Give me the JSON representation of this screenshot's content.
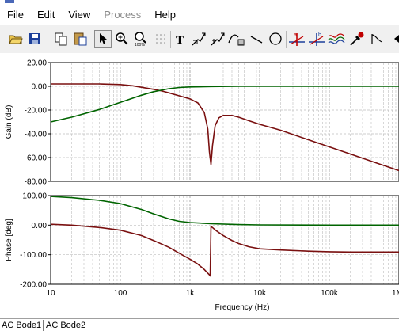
{
  "menu": [
    "File",
    "Edit",
    "View",
    "Process",
    "Help"
  ],
  "menu_disabled": [
    false,
    false,
    false,
    true,
    false
  ],
  "tabs": [
    "AC Bode1",
    "AC Bode2"
  ],
  "active_tab": 0,
  "colors": {
    "gain_trace": "#006400",
    "phase_trace": "#7a1010",
    "grid": "#bdbdbd"
  },
  "toolbar_icons": [
    "open-folder-icon",
    "save-icon",
    "copy-icon",
    "paste-icon",
    "pointer-icon",
    "zoom-in-icon",
    "zoom-100-icon",
    "grid-dots-icon",
    "text-tool-icon",
    "cursor-tool-icon",
    "cursor-tool-2-icon",
    "curve-fit-icon",
    "line-tool-icon",
    "circle-tool-icon",
    "marker-a-icon",
    "marker-b-icon",
    "multi-trace-icon",
    "probe-icon",
    "step-response-icon",
    "arrow-left-icon"
  ],
  "chart_data": [
    {
      "type": "line",
      "ylabel": "Gain (dB)",
      "yticks": [
        "20.00",
        "0.00",
        "-20.00",
        "-40.00",
        "-60.00",
        "-80.00"
      ],
      "ylim": [
        -80,
        20
      ],
      "xscale": "log",
      "xlim": [
        10,
        1000000
      ],
      "xticks": [],
      "grid": true,
      "series": [
        {
          "x": [
            10,
            20,
            50,
            100,
            150,
            200,
            300,
            400,
            500,
            700,
            1000,
            1300,
            1600,
            1800,
            1900,
            2000,
            2100,
            2300,
            2600,
            3000,
            4000,
            5000,
            7000,
            10000,
            20000,
            50000,
            100000,
            200000,
            500000,
            1000000
          ],
          "y": [
            2,
            2,
            2,
            1.5,
            0.5,
            -0.8,
            -2.5,
            -4,
            -5.5,
            -8,
            -10.5,
            -14,
            -22,
            -36,
            -55,
            -66,
            -50,
            -33,
            -26.5,
            -24.5,
            -24.5,
            -26,
            -29,
            -32,
            -37,
            -45,
            -51,
            -57,
            -65,
            -71
          ]
        },
        {
          "x": [
            10,
            20,
            50,
            100,
            200,
            300,
            500,
            700,
            1000,
            2000,
            5000,
            10000,
            100000,
            1000000
          ],
          "y": [
            -30,
            -26,
            -19.5,
            -13.5,
            -7.5,
            -4.5,
            -2,
            -1,
            -0.5,
            -0.2,
            0,
            0,
            0,
            0
          ]
        }
      ]
    },
    {
      "type": "line",
      "ylabel": "Phase [deg]",
      "yticks": [
        "100.00",
        "0.00",
        "-100.00",
        "-200.00"
      ],
      "ylim": [
        -200,
        100
      ],
      "xscale": "log",
      "xlim": [
        10,
        1000000
      ],
      "xticks": [
        "10",
        "100",
        "1k",
        "10k",
        "100k",
        "1M"
      ],
      "xlabel": "Frequency (Hz)",
      "grid": true,
      "series": [
        {
          "x": [
            10,
            20,
            50,
            100,
            200,
            300,
            500,
            700,
            1000,
            1300,
            1600,
            1900,
            1950,
            2000,
            2100,
            2300,
            2600,
            3000,
            4000,
            5000,
            7000,
            10000,
            20000,
            50000,
            100000,
            200000,
            500000,
            1000000
          ],
          "y": [
            3,
            0,
            -8,
            -17,
            -35,
            -52,
            -75,
            -95,
            -115,
            -132,
            -150,
            -168,
            -172,
            -5,
            -8,
            -16,
            -25,
            -35,
            -52,
            -62,
            -73,
            -80,
            -84,
            -88,
            -90,
            -91,
            -91,
            -91
          ]
        },
        {
          "x": [
            10,
            20,
            50,
            100,
            200,
            300,
            500,
            700,
            1000,
            2000,
            5000,
            10000,
            100000,
            1000000
          ],
          "y": [
            97,
            93,
            84,
            73,
            53,
            38,
            21,
            13,
            9,
            5,
            2,
            1,
            0,
            0
          ]
        }
      ]
    }
  ]
}
